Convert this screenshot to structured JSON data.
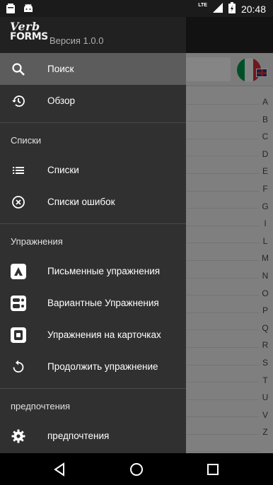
{
  "status_bar": {
    "time": "20:48",
    "network": "LTE",
    "icons": [
      "notification-icon",
      "android-icon",
      "signal-icon",
      "battery-charging-icon"
    ]
  },
  "drawer": {
    "logo_line1": "Verb",
    "logo_line2": "FORMS",
    "version": "Версия 1.0.0",
    "top_items": [
      {
        "label": "Поиск",
        "icon": "search-icon",
        "active": true
      },
      {
        "label": "Обзор",
        "icon": "history-icon",
        "active": false
      }
    ],
    "lists_header": "Списки",
    "lists_items": [
      {
        "label": "Списки",
        "icon": "list-icon"
      },
      {
        "label": "Списки ошибок",
        "icon": "cancel-circle-icon"
      }
    ],
    "exercises_header": "Упражнения",
    "exercises_items": [
      {
        "label": "Письменные упражнения",
        "icon": "written-exercise-icon"
      },
      {
        "label": "Вариантные Упражнения",
        "icon": "multiple-choice-icon"
      },
      {
        "label": "Упражнения на карточках",
        "icon": "flashcard-icon"
      },
      {
        "label": "Продолжить упражнение",
        "icon": "replay-icon"
      }
    ],
    "prefs_header": "предпочтения",
    "prefs_items": [
      {
        "label": "предпочтения",
        "icon": "gear-icon"
      }
    ]
  },
  "background": {
    "alphabet": [
      "A",
      "B",
      "C",
      "D",
      "E",
      "F",
      "G",
      "I",
      "L",
      "M",
      "N",
      "O",
      "P",
      "Q",
      "R",
      "S",
      "T",
      "U",
      "V",
      "Z"
    ],
    "flag_colors": [
      "#009246",
      "#f1f2f1",
      "#ce2b37"
    ]
  },
  "nav_bar": {
    "icons": [
      "back-icon",
      "home-icon",
      "recents-icon"
    ]
  }
}
